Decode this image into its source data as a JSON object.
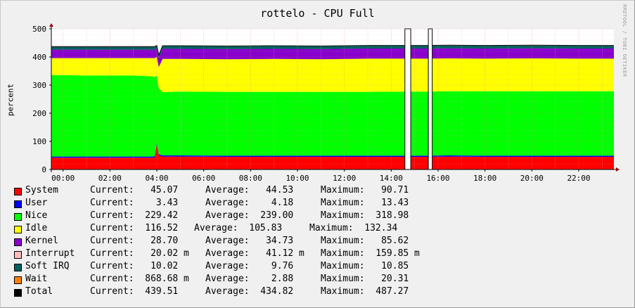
{
  "chart_data": {
    "type": "area",
    "title": "rottelo - CPU Full",
    "ylabel": "percent",
    "watermark": "RRDTOOL / TOBI OETIKER",
    "ylim": [
      0,
      500
    ],
    "yticks": [
      "0",
      "100",
      "200",
      "300",
      "400",
      "500"
    ],
    "xlim": [
      "23:30",
      "23:30"
    ],
    "xticks": [
      "00:00",
      "02:00",
      "04:00",
      "06:00",
      "08:00",
      "10:00",
      "12:00",
      "14:00",
      "16:00",
      "18:00",
      "20:00",
      "22:00"
    ],
    "grid": true,
    "x": [
      "23:30",
      "01:00",
      "03:00",
      "03:50",
      "03:55",
      "04:00",
      "04:05",
      "04:15",
      "05:00",
      "07:00",
      "09:00",
      "11:00",
      "13:00",
      "14:30",
      "15:30",
      "16:30",
      "18:00",
      "20:00",
      "22:00",
      "23:30"
    ],
    "series": [
      {
        "name": "System",
        "color": "#ff0000",
        "values": [
          42,
          42,
          42,
          42,
          44,
          90,
          50,
          46,
          46,
          45,
          45,
          45,
          45,
          45,
          45,
          46,
          45,
          45,
          45,
          45
        ]
      },
      {
        "name": "User",
        "color": "#0000ff",
        "values": [
          4,
          4,
          4,
          4,
          4,
          5,
          4,
          4,
          4,
          4,
          4,
          4,
          4,
          4,
          4,
          4,
          4,
          4,
          4,
          4
        ]
      },
      {
        "name": "Nice",
        "color": "#00ff00",
        "values": [
          290,
          288,
          288,
          285,
          280,
          240,
          235,
          225,
          227,
          227,
          227,
          227,
          227,
          228,
          228,
          228,
          229,
          229,
          229,
          229
        ]
      },
      {
        "name": "Idle",
        "color": "#ffff00",
        "values": [
          60,
          62,
          62,
          65,
          68,
          65,
          75,
          118,
          116,
          116,
          117,
          116,
          118,
          117,
          117,
          117,
          116,
          117,
          116,
          116
        ]
      },
      {
        "name": "Kernel",
        "color": "#8800cc",
        "values": [
          30,
          30,
          30,
          30,
          30,
          30,
          32,
          36,
          36,
          36,
          36,
          36,
          36,
          36,
          36,
          36,
          36,
          36,
          36,
          36
        ]
      },
      {
        "name": "Interrupt",
        "color": "#ffbbbb",
        "values": [
          0,
          0,
          0,
          0,
          0,
          0,
          0,
          0,
          0,
          0,
          0,
          0,
          0,
          0,
          0,
          0,
          0,
          0,
          0,
          0
        ]
      },
      {
        "name": "Soft IRQ",
        "color": "#006060",
        "values": [
          10,
          10,
          10,
          10,
          10,
          10,
          10,
          10,
          10,
          10,
          10,
          10,
          10,
          10,
          10,
          10,
          10,
          10,
          10,
          10
        ]
      },
      {
        "name": "Wait",
        "color": "#ff8000",
        "values": [
          1,
          1,
          1,
          1,
          1,
          1,
          1,
          1,
          1,
          1,
          1,
          1,
          1,
          1,
          1,
          1,
          1,
          1,
          1,
          1
        ]
      }
    ],
    "gaps": [
      [
        "14:35",
        "14:50"
      ],
      [
        "15:35",
        "15:45"
      ]
    ],
    "total": {
      "name": "Total",
      "color": "#000000"
    },
    "legend": [
      {
        "name": "System",
        "color": "#ff0000",
        "current": "Current:   45.07",
        "average": "Average:   44.53",
        "maximum": "Maximum:   90.71"
      },
      {
        "name": "User",
        "color": "#0000ff",
        "current": "Current:    3.43",
        "average": "Average:    4.18",
        "maximum": "Maximum:   13.43"
      },
      {
        "name": "Nice",
        "color": "#00ff00",
        "current": "Current:  229.42",
        "average": "Average:  239.00",
        "maximum": "Maximum:  318.98"
      },
      {
        "name": "Idle",
        "color": "#ffff00",
        "current": "Current:  116.52",
        "average": "Average:  105.83",
        "maximum": "Maximum:  132.34"
      },
      {
        "name": "Kernel",
        "color": "#8800cc",
        "current": "Current:   28.70",
        "average": "Average:   34.73",
        "maximum": "Maximum:   85.62"
      },
      {
        "name": "Interrupt",
        "color": "#ffbbbb",
        "current": "Current:   20.02 m",
        "average": "Average:   41.12 m",
        "maximum": "Maximum:  159.85 m"
      },
      {
        "name": "Soft IRQ",
        "color": "#006060",
        "current": "Current:   10.02",
        "average": "Average:    9.76",
        "maximum": "Maximum:   10.85"
      },
      {
        "name": "Wait",
        "color": "#ff8000",
        "current": "Current:  868.68 m",
        "average": "Average:    2.88",
        "maximum": "Maximum:   20.31"
      },
      {
        "name": "Total",
        "color": "#000000",
        "current": "Current:  439.51",
        "average": "Average:  434.82",
        "maximum": "Maximum:  487.27"
      }
    ]
  }
}
